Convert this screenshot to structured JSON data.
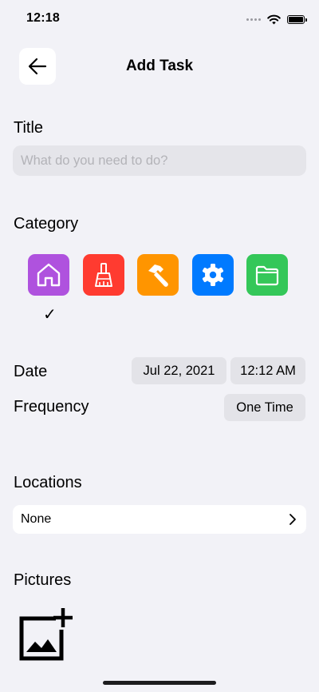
{
  "status_bar": {
    "time": "12:18"
  },
  "nav": {
    "title": "Add Task"
  },
  "title_section": {
    "label": "Title",
    "placeholder": "What do you need to do?",
    "value": ""
  },
  "category_section": {
    "label": "Category",
    "check": "✓",
    "selected": "home",
    "categories": [
      {
        "name": "home",
        "icon": "house-icon",
        "color": "#af52de"
      },
      {
        "name": "cleaning",
        "icon": "broom-icon",
        "color": "#ff3b30"
      },
      {
        "name": "repair",
        "icon": "hammer-icon",
        "color": "#ff9500"
      },
      {
        "name": "settings",
        "icon": "gear-icon",
        "color": "#007aff"
      },
      {
        "name": "files",
        "icon": "folder-icon",
        "color": "#34c759"
      }
    ]
  },
  "date_section": {
    "label": "Date",
    "date": "Jul 22, 2021",
    "time": "12:12 AM"
  },
  "frequency_section": {
    "label": "Frequency",
    "value": "One Time"
  },
  "locations_section": {
    "label": "Locations",
    "value": "None"
  },
  "pictures_section": {
    "label": "Pictures",
    "add_icon": "add-photo-icon"
  }
}
